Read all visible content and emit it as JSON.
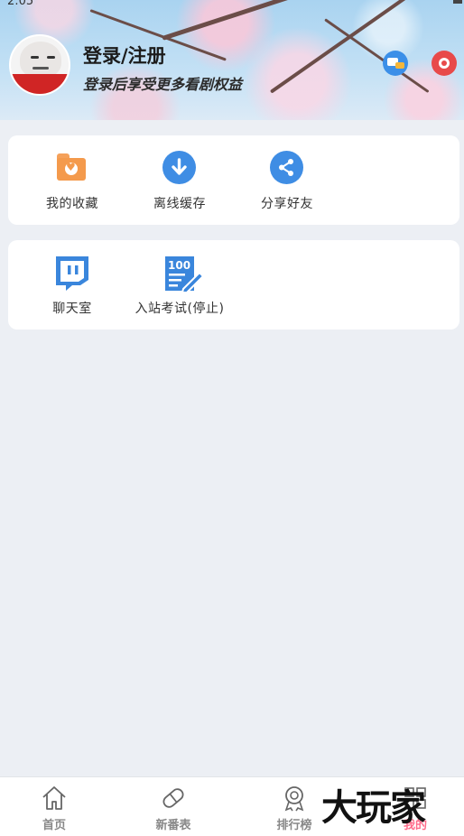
{
  "status_bar": {
    "time": "2:05"
  },
  "header": {
    "login_title": "登录/注册",
    "login_subtitle": "登录后享受更多看剧权益",
    "message_icon": "chat-bubble-icon",
    "settings_icon": "gear-icon"
  },
  "quick_actions": [
    {
      "label": "我的收藏",
      "icon": "favorites-folder-icon"
    },
    {
      "label": "离线缓存",
      "icon": "download-icon"
    },
    {
      "label": "分享好友",
      "icon": "share-icon"
    }
  ],
  "tools": [
    {
      "label": "聊天室",
      "icon": "chat-room-icon"
    },
    {
      "label": "入站考试(停止)",
      "icon": "exam-icon"
    }
  ],
  "tab_bar": [
    {
      "label": "首页",
      "icon": "home-icon"
    },
    {
      "label": "新番表",
      "icon": "pill-icon"
    },
    {
      "label": "排行榜",
      "icon": "ranking-medal-icon"
    },
    {
      "label": "我的",
      "icon": "profile-grid-icon"
    }
  ],
  "watermark": "大玩家",
  "colors": {
    "accent_blue": "#3f8de4",
    "orange": "#f49a4c",
    "background": "#eceff4",
    "active_tab": "#ff6b8a"
  }
}
